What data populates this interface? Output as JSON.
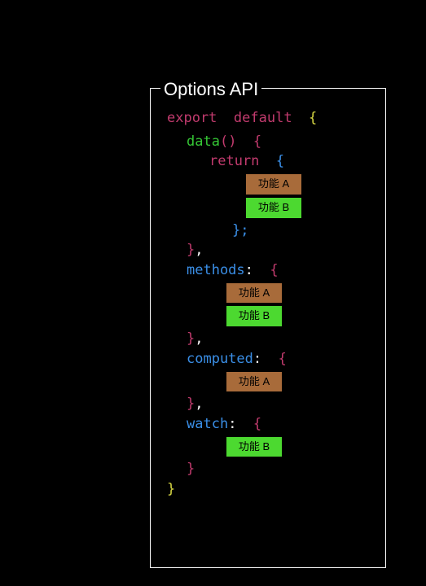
{
  "panel": {
    "title": "Options API"
  },
  "code": {
    "export": "export",
    "default": "default",
    "data": "data",
    "return": "return",
    "methods": "methods",
    "computed": "computed",
    "watch": "watch"
  },
  "badges": {
    "featureA": "功能 A",
    "featureB": "功能 B"
  }
}
